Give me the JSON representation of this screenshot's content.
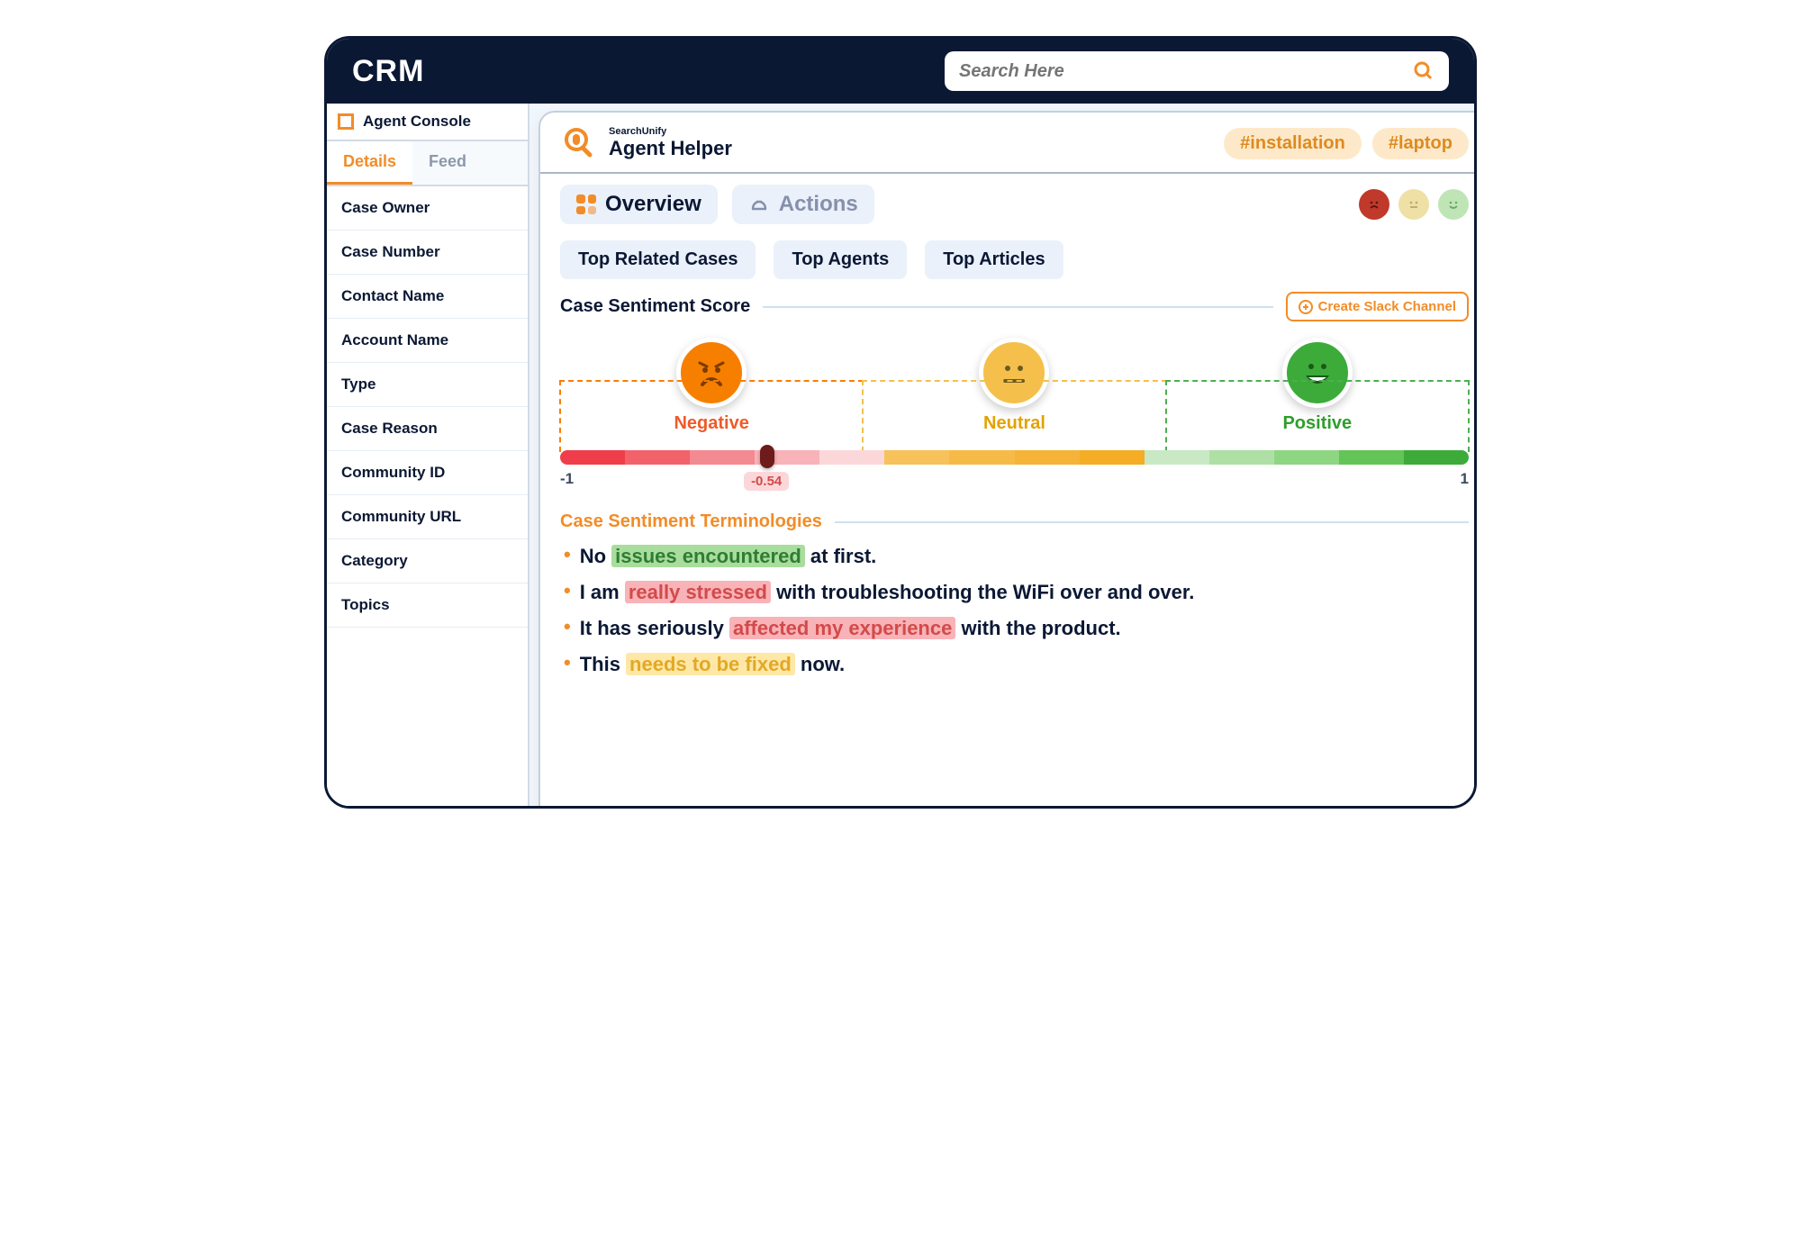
{
  "header": {
    "brand": "CRM",
    "search_placeholder": "Search Here"
  },
  "sidebar": {
    "console_label": "Agent Console",
    "tabs": [
      {
        "label": "Details",
        "active": true
      },
      {
        "label": "Feed",
        "active": false
      }
    ],
    "fields": [
      "Case Owner",
      "Case Number",
      "Contact Name",
      "Account Name",
      "Type",
      "Case Reason",
      "Community ID",
      "Community URL",
      "Category",
      "Topics"
    ]
  },
  "helper": {
    "vendor": "SearchUnify",
    "title": "Agent Helper",
    "tags": [
      "#installation",
      "#laptop"
    ],
    "modes": {
      "overview": "Overview",
      "actions": "Actions"
    },
    "top_tabs": [
      "Top Related Cases",
      "Top Agents",
      "Top Articles"
    ],
    "sentiment_section_title": "Case Sentiment Score",
    "slack_label": "Create Slack Channel",
    "labels": {
      "negative": "Negative",
      "neutral": "Neutral",
      "positive": "Positive"
    },
    "range_min": "-1",
    "range_max": "1",
    "score": "-0.54",
    "terminologies_title": "Case Sentiment Terminologies",
    "terms": [
      {
        "pre": "No ",
        "hl": "issues encountered",
        "post": " at first.",
        "class": "green"
      },
      {
        "pre": "I am ",
        "hl": "really stressed",
        "post": " with troubleshooting the WiFi over and over.",
        "class": "red"
      },
      {
        "pre": "It has seriously ",
        "hl": "affected my experience",
        "post": " with the product.",
        "class": "red"
      },
      {
        "pre": "This ",
        "hl": "needs to be fixed",
        "post": " now.",
        "class": "yellow"
      }
    ]
  }
}
